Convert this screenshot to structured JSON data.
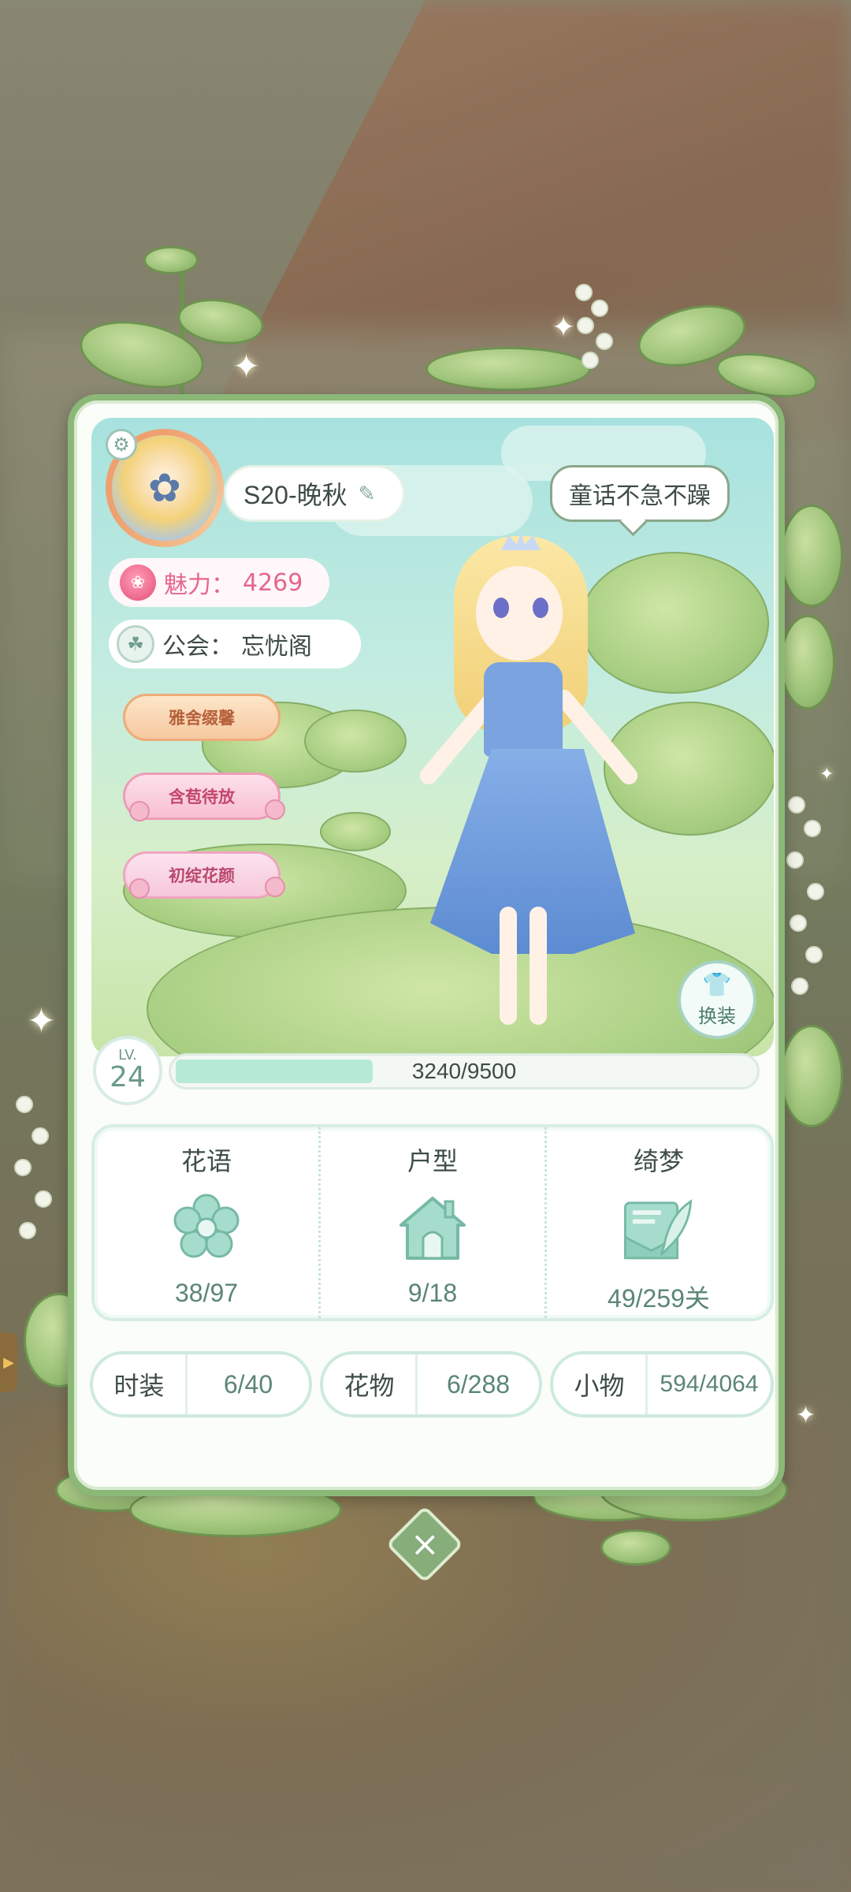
{
  "profile": {
    "name": "S20-晚秋",
    "speech": "童话不急不躁",
    "charm_label": "魅力：",
    "charm_value": "4269",
    "guild_label": "公会：",
    "guild_value": "忘忧阁",
    "titles": [
      "雅舍缀馨",
      "含苞待放",
      "初绽花颜"
    ],
    "dressup_label": "换装"
  },
  "level": {
    "prefix": "LV.",
    "value": "24",
    "progress_text": "3240/9500",
    "current": 3240,
    "max": 9500
  },
  "stats": [
    {
      "title": "花语",
      "value": "38/97",
      "icon": "flower-icon"
    },
    {
      "title": "户型",
      "value": "9/18",
      "icon": "house-icon"
    },
    {
      "title": "绮梦",
      "value": "49/259关",
      "icon": "letter-quill-icon"
    }
  ],
  "collections": [
    {
      "label": "时装",
      "value": "6/40"
    },
    {
      "label": "花物",
      "value": "6/288"
    },
    {
      "label": "小物",
      "value": "594/4064"
    }
  ],
  "icons": {
    "close": "close-icon",
    "settings": "settings-icon",
    "edit": "edit-icon",
    "charm": "rose-icon",
    "guild": "guild-emblem-icon",
    "dressup": "shirt-icon"
  },
  "colors": {
    "card_border": "#8bb876",
    "accent_mint": "#8ccfba",
    "charm_pink": "#e6668c",
    "close_button": "#86ad7a"
  }
}
